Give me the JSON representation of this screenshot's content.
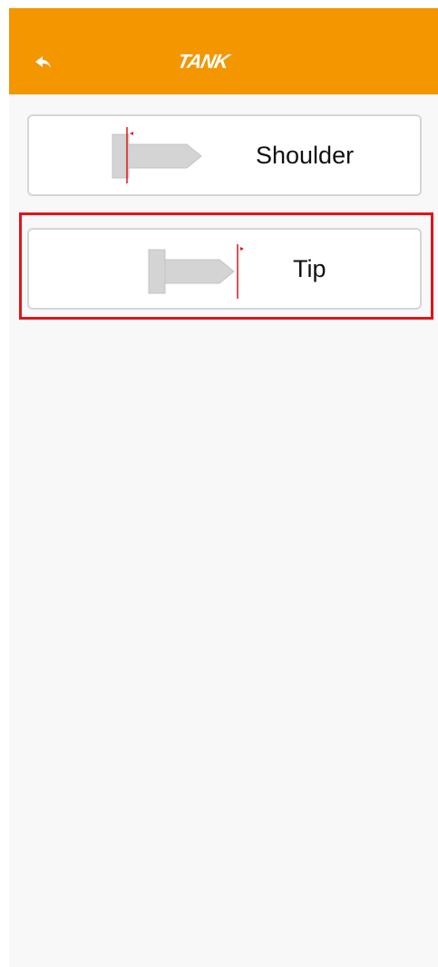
{
  "header": {
    "brand": "TANK",
    "back_icon": "back-arrow-icon",
    "background_color": "#f39600"
  },
  "options": [
    {
      "label": "Shoulder",
      "icon": "shoulder-measure-icon",
      "selected": false
    },
    {
      "label": "Tip",
      "icon": "tip-measure-icon",
      "selected": true
    }
  ],
  "colors": {
    "accent": "#f39600",
    "highlight": "#e0141b",
    "card_border": "#d6d6d6",
    "background": "#f8f8f8"
  }
}
